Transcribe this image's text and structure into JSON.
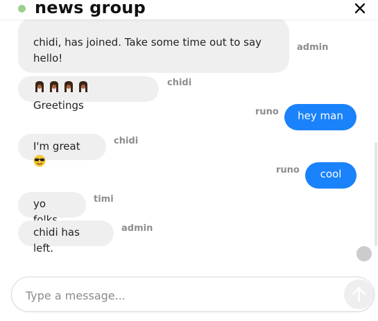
{
  "header": {
    "title": "news group",
    "status_color": "#9bd18f",
    "close_icon": "close-icon"
  },
  "messages": [
    {
      "sender": "admin",
      "text": "chidi, has joined. Take some time out to say hello!",
      "direction": "incoming"
    },
    {
      "sender": "chidi",
      "text": "Greetings",
      "direction": "incoming",
      "emoji": "person-with-raised-hands x4"
    },
    {
      "sender": "runo",
      "text": "hey man",
      "direction": "outgoing"
    },
    {
      "sender": "chidi",
      "text": "I'm great",
      "direction": "incoming",
      "emoji": "sunglasses-face"
    },
    {
      "sender": "runo",
      "text": "cool",
      "direction": "outgoing"
    },
    {
      "sender": "timi",
      "text": "yo folks",
      "direction": "incoming"
    },
    {
      "sender": "admin",
      "text": "chidi has left.",
      "direction": "incoming"
    }
  ],
  "composer": {
    "placeholder": "Type a message...",
    "value": "",
    "send_icon": "arrow-up-icon"
  },
  "colors": {
    "outgoing_bubble": "#1a82fb",
    "incoming_bubble": "#efefef",
    "sender_label": "#8d8d8d"
  }
}
